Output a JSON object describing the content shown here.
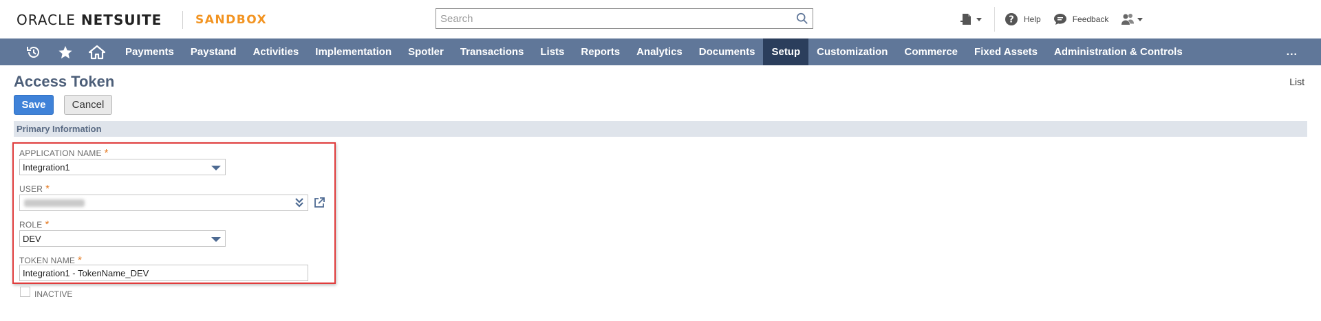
{
  "header": {
    "brand_oracle": "ORACLE",
    "brand_netsuite": "NETSUITE",
    "environment": "SANDBOX",
    "search_placeholder": "Search",
    "help_label": "Help",
    "feedback_label": "Feedback"
  },
  "nav": {
    "items": [
      "Payments",
      "Paystand",
      "Activities",
      "Implementation",
      "Spotler",
      "Transactions",
      "Lists",
      "Reports",
      "Analytics",
      "Documents",
      "Setup",
      "Customization",
      "Commerce",
      "Fixed Assets",
      "Administration & Controls"
    ],
    "active": "Setup",
    "more": "..."
  },
  "page": {
    "title": "Access Token",
    "list_link": "List",
    "save_label": "Save",
    "cancel_label": "Cancel",
    "section_title": "Primary Information"
  },
  "form": {
    "application_name_label": "APPLICATION NAME",
    "application_name_value": "Integration1",
    "user_label": "USER",
    "role_label": "ROLE",
    "role_value": "DEV",
    "token_name_label": "TOKEN NAME",
    "token_name_value": "Integration1 - TokenName_DEV",
    "inactive_label": "INACTIVE",
    "required_mark": "*"
  },
  "colors": {
    "nav_bg": "#607799",
    "nav_active": "#2b3e5c",
    "save_button": "#3f82d8",
    "sandbox_accent": "#f29422",
    "highlight": "#e03c3c"
  }
}
